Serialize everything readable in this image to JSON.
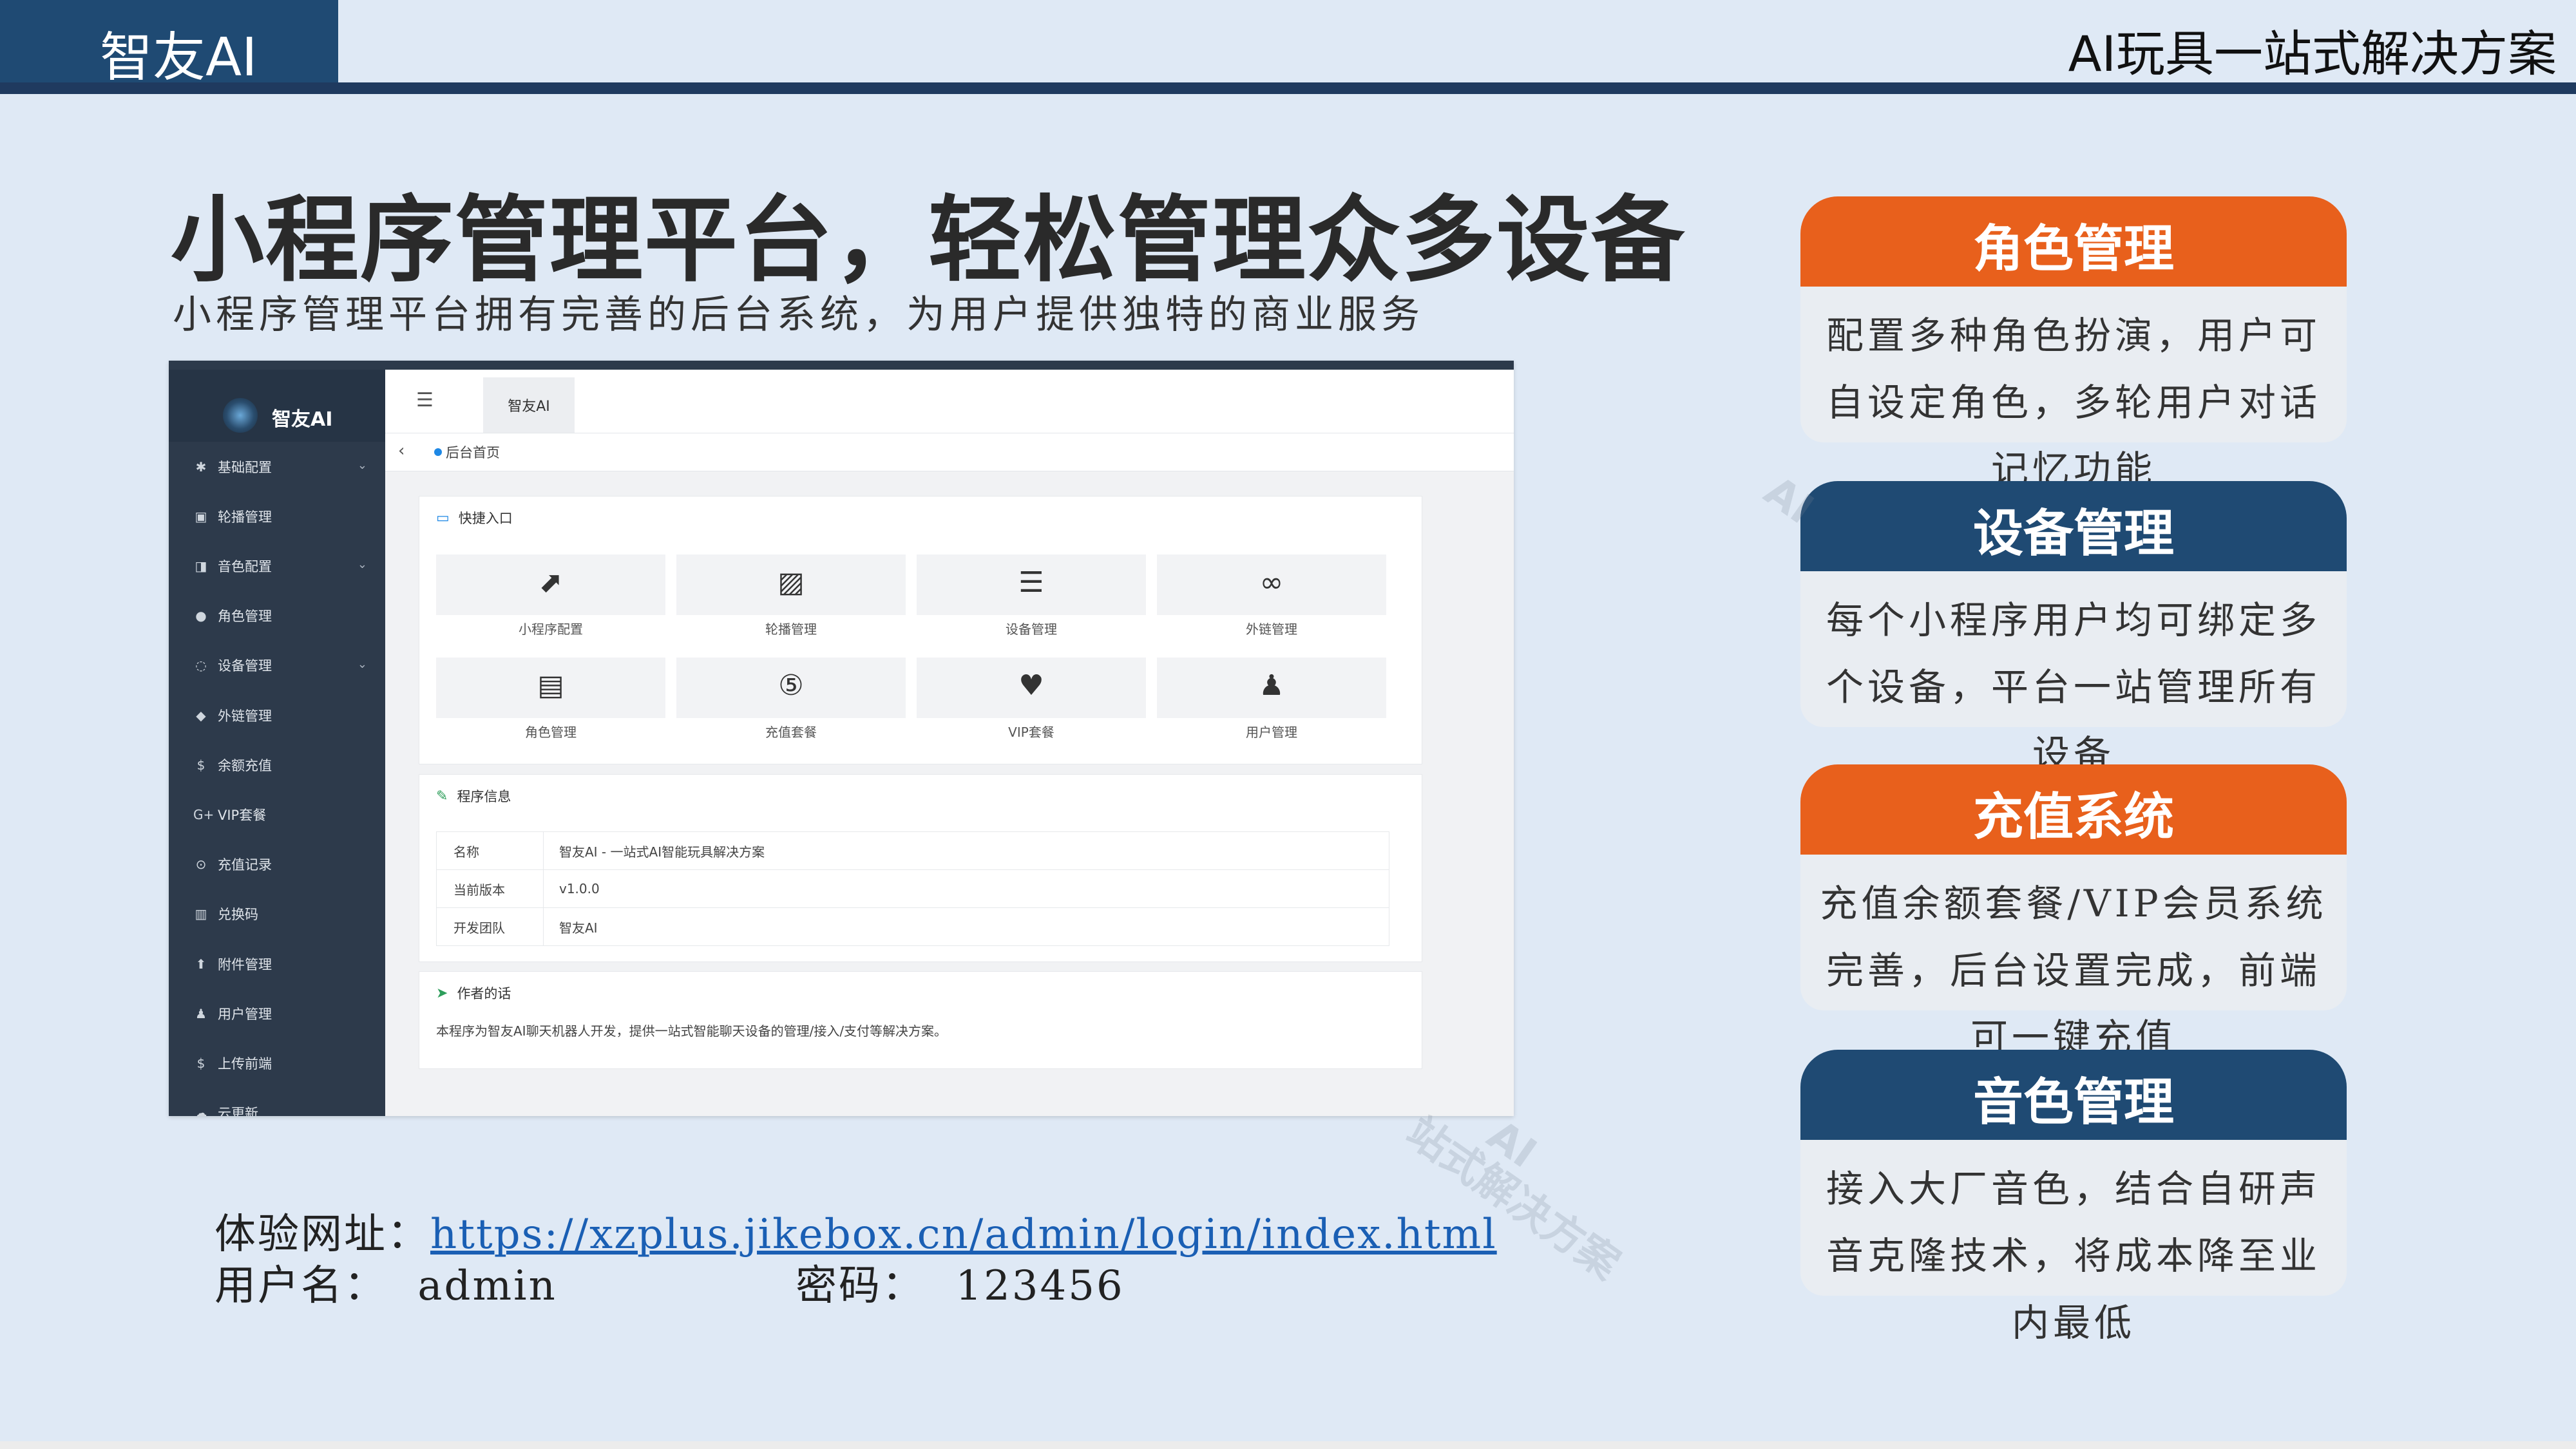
{
  "header": {
    "brand": "智友AI",
    "right_title": "AI玩具一站式解决方案"
  },
  "main": {
    "title": "小程序管理平台，轻松管理众多设备",
    "subtitle": "小程序管理平台拥有完善的后台系统，为用户提供独特的商业服务"
  },
  "screenshot": {
    "sidebar": {
      "logo_text": "智友AI",
      "items": [
        {
          "label": "基础配置",
          "icon": "gear-icon",
          "glyph": "✱",
          "expandable": true
        },
        {
          "label": "轮播管理",
          "icon": "image-icon",
          "glyph": "▣",
          "expandable": false
        },
        {
          "label": "音色配置",
          "icon": "sound-icon",
          "glyph": "◨",
          "expandable": true
        },
        {
          "label": "角色管理",
          "icon": "role-icon",
          "glyph": "●",
          "expandable": false
        },
        {
          "label": "设备管理",
          "icon": "device-icon",
          "glyph": "◌",
          "expandable": true
        },
        {
          "label": "外链管理",
          "icon": "link-icon",
          "glyph": "◆",
          "expandable": false
        },
        {
          "label": "余额充值",
          "icon": "recharge-icon",
          "glyph": "$",
          "expandable": false
        },
        {
          "label": "VIP套餐",
          "icon": "vip-icon",
          "glyph": "G+",
          "expandable": false
        },
        {
          "label": "充值记录",
          "icon": "record-icon",
          "glyph": "⊙",
          "expandable": false
        },
        {
          "label": "兑换码",
          "icon": "barcode-icon",
          "glyph": "▥",
          "expandable": false
        },
        {
          "label": "附件管理",
          "icon": "upload-icon",
          "glyph": "⬆",
          "expandable": false
        },
        {
          "label": "用户管理",
          "icon": "user-icon",
          "glyph": "♟",
          "expandable": false
        },
        {
          "label": "上传前端",
          "icon": "upload-front-icon",
          "glyph": "$",
          "expandable": false
        },
        {
          "label": "云更新",
          "icon": "cloud-icon",
          "glyph": "☁",
          "expandable": false
        }
      ]
    },
    "header_tab": "智友AI",
    "breadcrumb": "后台首页",
    "quick": {
      "title": "快捷入口",
      "tiles": [
        {
          "label": "小程序配置",
          "icon": "external-icon",
          "glyph": "⬈"
        },
        {
          "label": "轮播管理",
          "icon": "image-icon",
          "glyph": "▨"
        },
        {
          "label": "设备管理",
          "icon": "database-icon",
          "glyph": "☰"
        },
        {
          "label": "外链管理",
          "icon": "link-icon",
          "glyph": "∞"
        },
        {
          "label": "角色管理",
          "icon": "id-card-icon",
          "glyph": "▤"
        },
        {
          "label": "充值套餐",
          "icon": "coin-icon",
          "glyph": "⑤"
        },
        {
          "label": "VIP套餐",
          "icon": "heart-icon",
          "glyph": "♥"
        },
        {
          "label": "用户管理",
          "icon": "user-icon",
          "glyph": "♟"
        }
      ]
    },
    "program_info": {
      "title": "程序信息",
      "rows": [
        {
          "key": "名称",
          "value": "智友AI - 一站式AI智能玩具解决方案"
        },
        {
          "key": "当前版本",
          "value": "v1.0.0"
        },
        {
          "key": "开发团队",
          "value": "智友AI"
        }
      ]
    },
    "author": {
      "title": "作者的话",
      "text": "本程序为智友AI聊天机器人开发，提供一站式智能聊天设备的管理/接入/支付等解决方案。"
    }
  },
  "access": {
    "exp_label": "体验网址：",
    "url": "https://xzplus.jikebox.cn/admin/login/index.html",
    "user_label": "用户名：",
    "user": "admin",
    "pass_label": "密码：",
    "pass": "123456"
  },
  "features": [
    {
      "title": "角色管理",
      "desc": "配置多种角色扮演，用户可自设定角色，多轮用户对话记忆功能",
      "color": "#e8601c"
    },
    {
      "title": "设备管理",
      "desc": "每个小程序用户均可绑定多个设备，平台一站管理所有设备",
      "color": "#1f4a73"
    },
    {
      "title": "充值系统",
      "desc": "充值余额套餐/VIP会员系统完善，后台设置完成，前端可一键充值",
      "color": "#e8601c"
    },
    {
      "title": "音色管理",
      "desc": "接入大厂音色，结合自研声音克隆技术，将成本降至业内最低",
      "color": "#1f4a73"
    }
  ],
  "watermark": {
    "brand": "AI",
    "tagline": "站式解决方案"
  }
}
